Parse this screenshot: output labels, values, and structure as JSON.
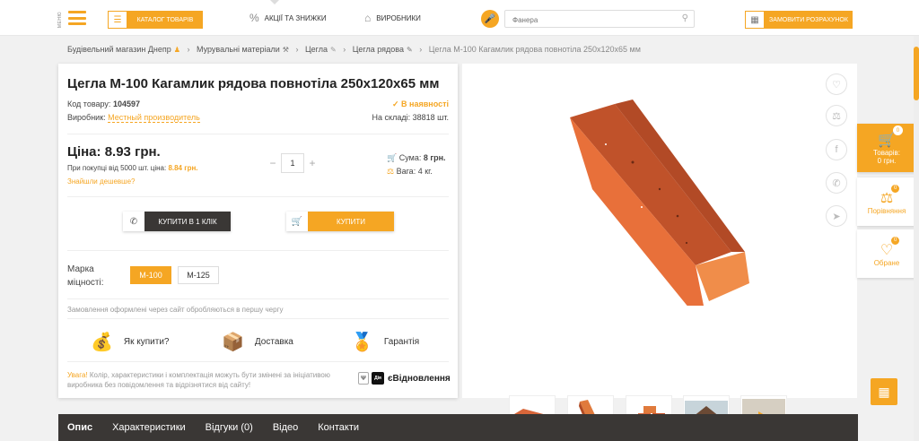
{
  "header": {
    "menu_label": "МЕНЮ",
    "catalog_label": "Каталог товарів",
    "promo_label": "Акції та знижки",
    "brands_label": "Виробники",
    "search_placeholder": "Фанера",
    "calc_label": "Замовити розрахунок"
  },
  "breadcrumb": [
    "Будівельний магазин Днепр",
    "Мурувальні матеріали",
    "Цегла",
    "Цегла рядова",
    "Цегла М-100 Кагамлик рядова повнотіла 250х120х65 мм"
  ],
  "product": {
    "title": "Цегла М-100 Кагамлик рядова повнотіла 250х120х65 мм",
    "code_label": "Код товару:",
    "code": "104597",
    "availability": "В наявності",
    "maker_label": "Виробник:",
    "maker": "Местный производитель",
    "stock_label": "На складі:",
    "stock": "38818 шт.",
    "price_label": "Ціна:",
    "price": "8.93 грн.",
    "bulk_text": "При покупці від 5000 шт. ціна:",
    "bulk_price": "8.84 грн.",
    "cheaper_link": "Знайшли дешевше?",
    "quantity": "1",
    "sum_label": "Сума:",
    "sum": "8 грн.",
    "weight_label": "Вага:",
    "weight": "4 кг.",
    "one_click": "Купити в 1 клік",
    "buy": "Купити",
    "grade_label": "Марка міцності:",
    "grades": [
      "М-100",
      "М-125"
    ],
    "order_note": "Замовлення оформлені через сайт обробляються в першу чергу",
    "how_buy": "Як купити?",
    "delivery": "Доставка",
    "warranty": "Гарантія",
    "warning_prefix": "Увага!",
    "warning_text": "Колір, характеристики і комплектація можуть бути змінені за ініціативою виробника без повідомлення та відрізнятися від сайту!",
    "diia": "Дія",
    "ev_label": "єВідновлення"
  },
  "sidebar": {
    "cart_label": "Товарів:",
    "cart_value": "0 грн.",
    "cart_count": "0",
    "compare_label": "Порівняння",
    "compare_count": "0",
    "fav_label": "Обране",
    "fav_count": "0"
  },
  "tabs": [
    "Опис",
    "Характеристики",
    "Відгуки (0)",
    "Відео",
    "Контакти"
  ],
  "colors": {
    "accent": "#f5a623",
    "dark": "#3a3735",
    "brick": "#e07a3c"
  }
}
